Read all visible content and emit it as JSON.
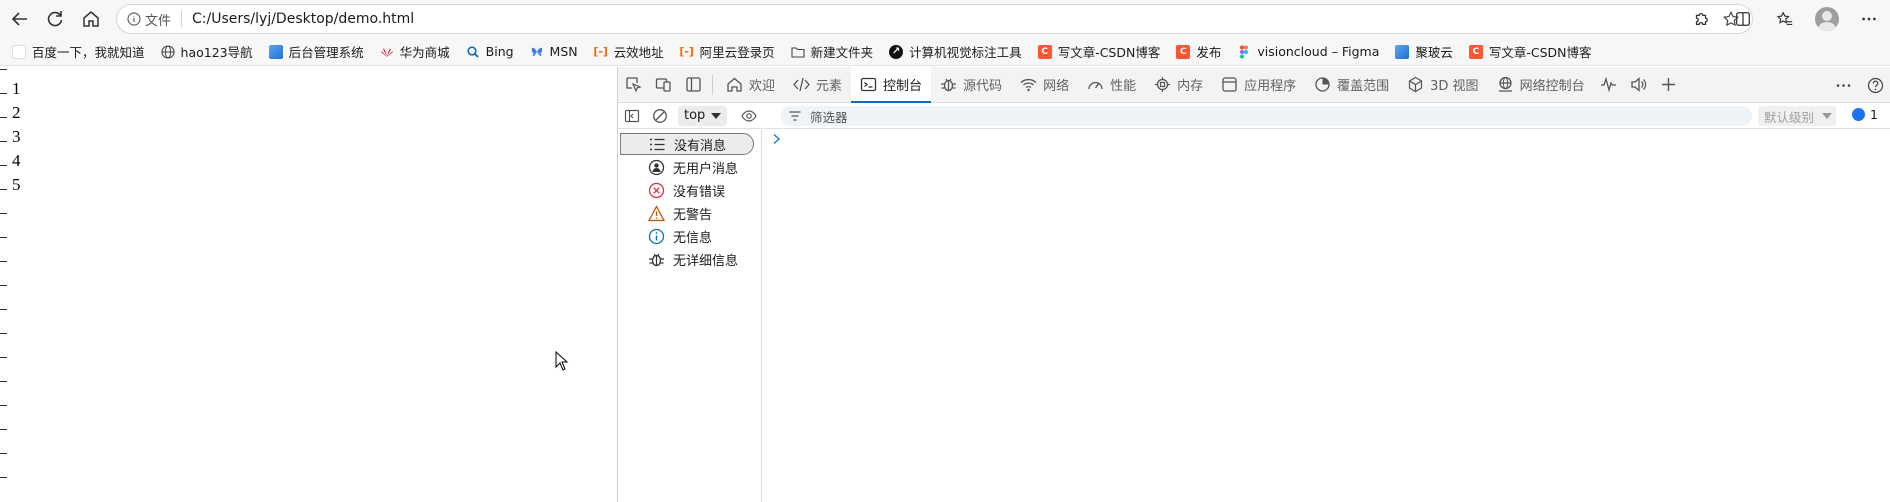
{
  "browser": {
    "address_label": "文件",
    "url": "C:/Users/lyj/Desktop/demo.html"
  },
  "bookmarks": [
    {
      "label": "百度一下，我就知道",
      "icon": "blank-page-icon"
    },
    {
      "label": "hao123导航",
      "icon": "globe-icon"
    },
    {
      "label": "后台管理系统",
      "icon": "blue-bookmark-icon"
    },
    {
      "label": "华为商城",
      "icon": "huawei-icon",
      "color": "#e31d2d"
    },
    {
      "label": "Bing",
      "icon": "search-icon"
    },
    {
      "label": "MSN",
      "icon": "msn-butterfly-icon"
    },
    {
      "label": "云效地址",
      "icon": "aliyun-icon",
      "color": "#ff6a00"
    },
    {
      "label": "阿里云登录页",
      "icon": "aliyun-icon",
      "color": "#ff6a00"
    },
    {
      "label": "新建文件夹",
      "icon": "folder-icon"
    },
    {
      "label": "计算机视觉标注工具",
      "icon": "arrow-logo-icon"
    },
    {
      "label": "写文章-CSDN博客",
      "icon": "csdn-icon",
      "color": "#fc5531"
    },
    {
      "label": "发布",
      "icon": "csdn-icon",
      "color": "#fc5531"
    },
    {
      "label": "visioncloud – Figma",
      "icon": "figma-icon"
    },
    {
      "label": "聚玻云",
      "icon": "blue-bookmark-icon"
    },
    {
      "label": "写文章-CSDN博客",
      "icon": "csdn-icon",
      "color": "#fc5531"
    }
  ],
  "page": {
    "lines": [
      "1",
      "2",
      "3",
      "4",
      "5"
    ]
  },
  "devtools": {
    "tabs": [
      {
        "label": "欢迎",
        "icon": "home-icon"
      },
      {
        "label": "元素",
        "icon": "code-icon"
      },
      {
        "label": "控制台",
        "icon": "console-icon",
        "active": true
      },
      {
        "label": "源代码",
        "icon": "bug-icon"
      },
      {
        "label": "网络",
        "icon": "wifi-icon"
      },
      {
        "label": "性能",
        "icon": "gauge-icon"
      },
      {
        "label": "内存",
        "icon": "chip-icon"
      },
      {
        "label": "应用程序",
        "icon": "app-window-icon"
      },
      {
        "label": "覆盖范围",
        "icon": "coverage-icon"
      },
      {
        "label": "3D 视图",
        "icon": "cube-icon"
      },
      {
        "label": "网络控制台",
        "icon": "network-console-icon"
      }
    ],
    "toolbar": {
      "context": "top",
      "filter_placeholder": "筛选器",
      "levels": "默认级别",
      "issues_count": "1"
    },
    "sidebar": [
      {
        "label": "没有消息",
        "icon": "list-icon",
        "selected": true
      },
      {
        "label": "无用户消息",
        "icon": "user-icon"
      },
      {
        "label": "没有错误",
        "icon": "error-icon",
        "color": "#d13438"
      },
      {
        "label": "无警告",
        "icon": "warning-icon",
        "color": "#c45500"
      },
      {
        "label": "无信息",
        "icon": "info-icon",
        "color": "#0f6cbd"
      },
      {
        "label": "无详细信息",
        "icon": "bug-icon"
      }
    ]
  }
}
